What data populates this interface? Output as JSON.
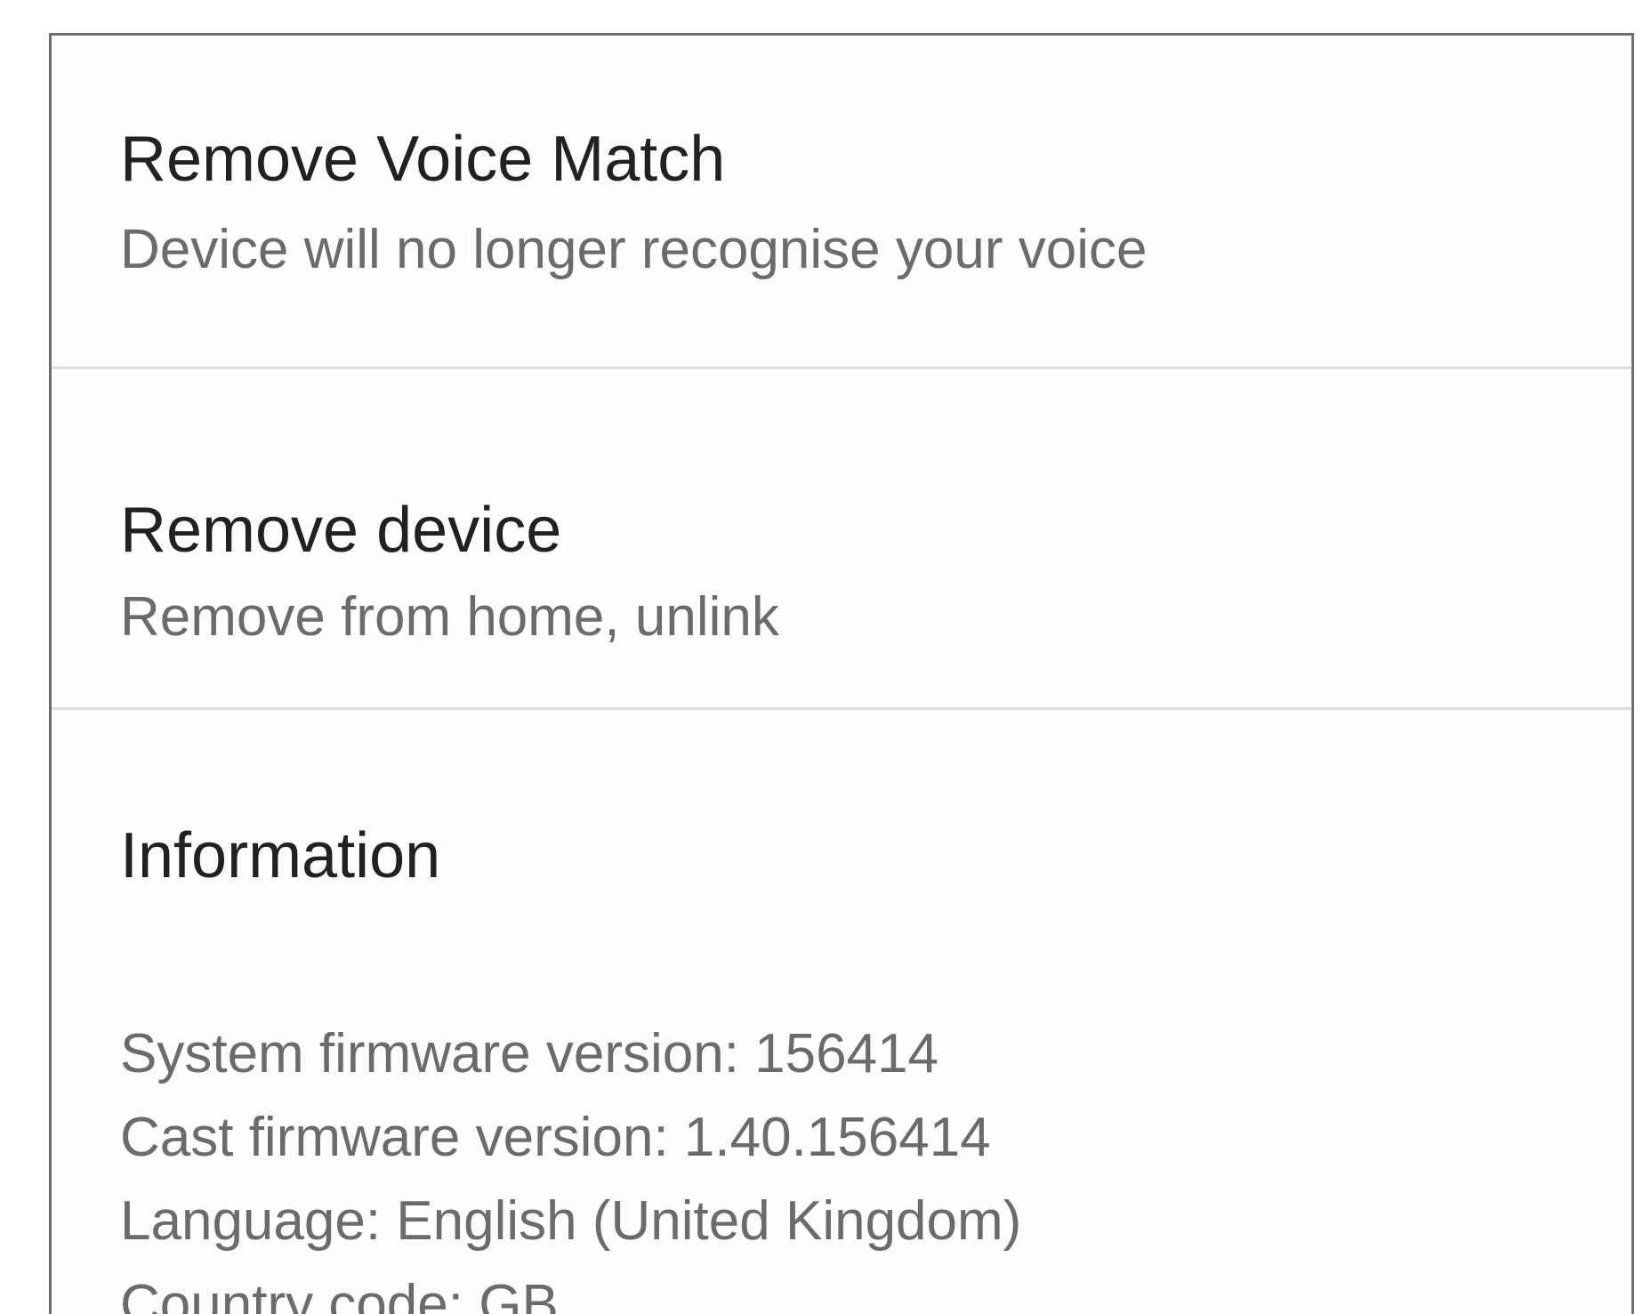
{
  "settings": {
    "items": [
      {
        "title": "Remove Voice Match",
        "subtitle": "Device will no longer recognise your voice"
      },
      {
        "title": "Remove device",
        "subtitle": "Remove from home, unlink"
      }
    ],
    "information": {
      "heading": "Information",
      "lines": [
        "System firmware version: 156414",
        "Cast firmware version: 1.40.156414",
        "Language: English (United Kingdom)",
        "Country code: GB"
      ]
    }
  }
}
